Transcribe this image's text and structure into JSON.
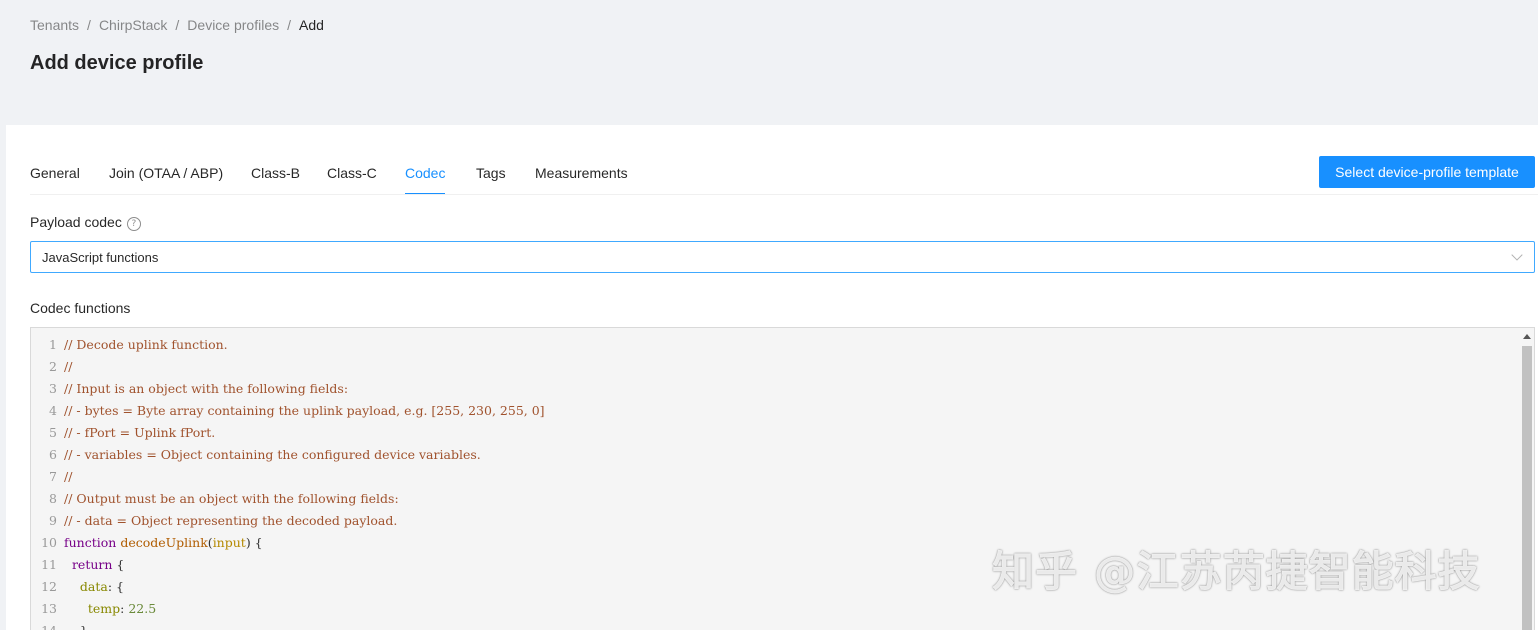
{
  "breadcrumb": {
    "items": [
      "Tenants",
      "ChirpStack",
      "Device profiles"
    ],
    "current": "Add",
    "separator": "/"
  },
  "page": {
    "title": "Add device profile"
  },
  "tabs": [
    {
      "label": "General",
      "active": false
    },
    {
      "label": "Join (OTAA / ABP)",
      "active": false
    },
    {
      "label": "Class-B",
      "active": false
    },
    {
      "label": "Class-C",
      "active": false
    },
    {
      "label": "Codec",
      "active": true
    },
    {
      "label": "Tags",
      "active": false
    },
    {
      "label": "Measurements",
      "active": false
    }
  ],
  "template_button": {
    "label": "Select device-profile template"
  },
  "payload_codec": {
    "label": "Payload codec",
    "help_icon": "question-circle-icon",
    "value": "JavaScript functions"
  },
  "codec_functions": {
    "label": "Codec functions",
    "lines": [
      [
        {
          "t": "comment",
          "v": "// Decode uplink function."
        }
      ],
      [
        {
          "t": "comment",
          "v": "//"
        }
      ],
      [
        {
          "t": "comment",
          "v": "// Input is an object with the following fields:"
        }
      ],
      [
        {
          "t": "comment",
          "v": "// - bytes = Byte array containing the uplink payload, e.g. [255, 230, 255, 0]"
        }
      ],
      [
        {
          "t": "comment",
          "v": "// - fPort = Uplink fPort."
        }
      ],
      [
        {
          "t": "comment",
          "v": "// - variables = Object containing the configured device variables."
        }
      ],
      [
        {
          "t": "comment",
          "v": "//"
        }
      ],
      [
        {
          "t": "comment",
          "v": "// Output must be an object with the following fields:"
        }
      ],
      [
        {
          "t": "comment",
          "v": "// - data = Object representing the decoded payload."
        }
      ],
      [
        {
          "t": "keyword",
          "v": "function "
        },
        {
          "t": "def",
          "v": "decodeUplink"
        },
        {
          "t": "punct",
          "v": "("
        },
        {
          "t": "var",
          "v": "input"
        },
        {
          "t": "punct",
          "v": ") {"
        }
      ],
      [
        {
          "t": "plain",
          "v": "  "
        },
        {
          "t": "keyword",
          "v": "return"
        },
        {
          "t": "punct",
          "v": " {"
        }
      ],
      [
        {
          "t": "plain",
          "v": "    "
        },
        {
          "t": "prop",
          "v": "data"
        },
        {
          "t": "punct",
          "v": ": {"
        }
      ],
      [
        {
          "t": "plain",
          "v": "      "
        },
        {
          "t": "prop",
          "v": "temp"
        },
        {
          "t": "punct",
          "v": ": "
        },
        {
          "t": "number",
          "v": "22.5"
        }
      ],
      [
        {
          "t": "plain",
          "v": "    "
        },
        {
          "t": "punct",
          "v": "}"
        }
      ]
    ]
  },
  "watermark": {
    "text": "知乎 @江苏芮捷智能科技"
  },
  "colors": {
    "accent": "#1890ff",
    "background": "#f0f2f5",
    "card": "#ffffff"
  }
}
